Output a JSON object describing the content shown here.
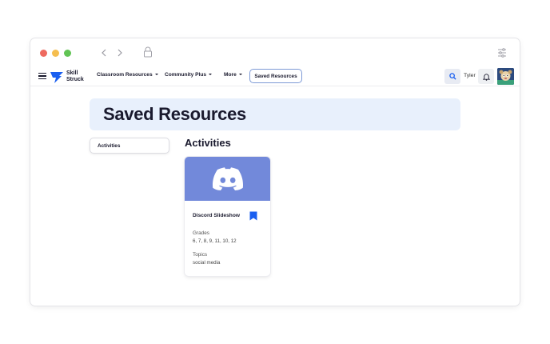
{
  "navbar": {
    "logo_text_line1": "Skill",
    "logo_text_line2": "Struck",
    "menu": [
      {
        "label": "Classroom Resources"
      },
      {
        "label": "Community Plus"
      },
      {
        "label": "More"
      }
    ],
    "saved_button_label": "Saved Resources",
    "user_name": "Tyler"
  },
  "page": {
    "title": "Saved Resources",
    "sidebar_tab": "Activities",
    "section_title": "Activities"
  },
  "cards": [
    {
      "title": "Discord Slideshow",
      "grades_label": "Grades",
      "grades_value": "6, 7, 8, 9, 11, 10, 12",
      "topics_label": "Topics",
      "topics_value": "social media",
      "bookmarked": true
    }
  ],
  "colors": {
    "accent_blue": "#1a5ff0",
    "hero_bg": "#e8f0fc",
    "discord_blurple": "#7289da"
  }
}
